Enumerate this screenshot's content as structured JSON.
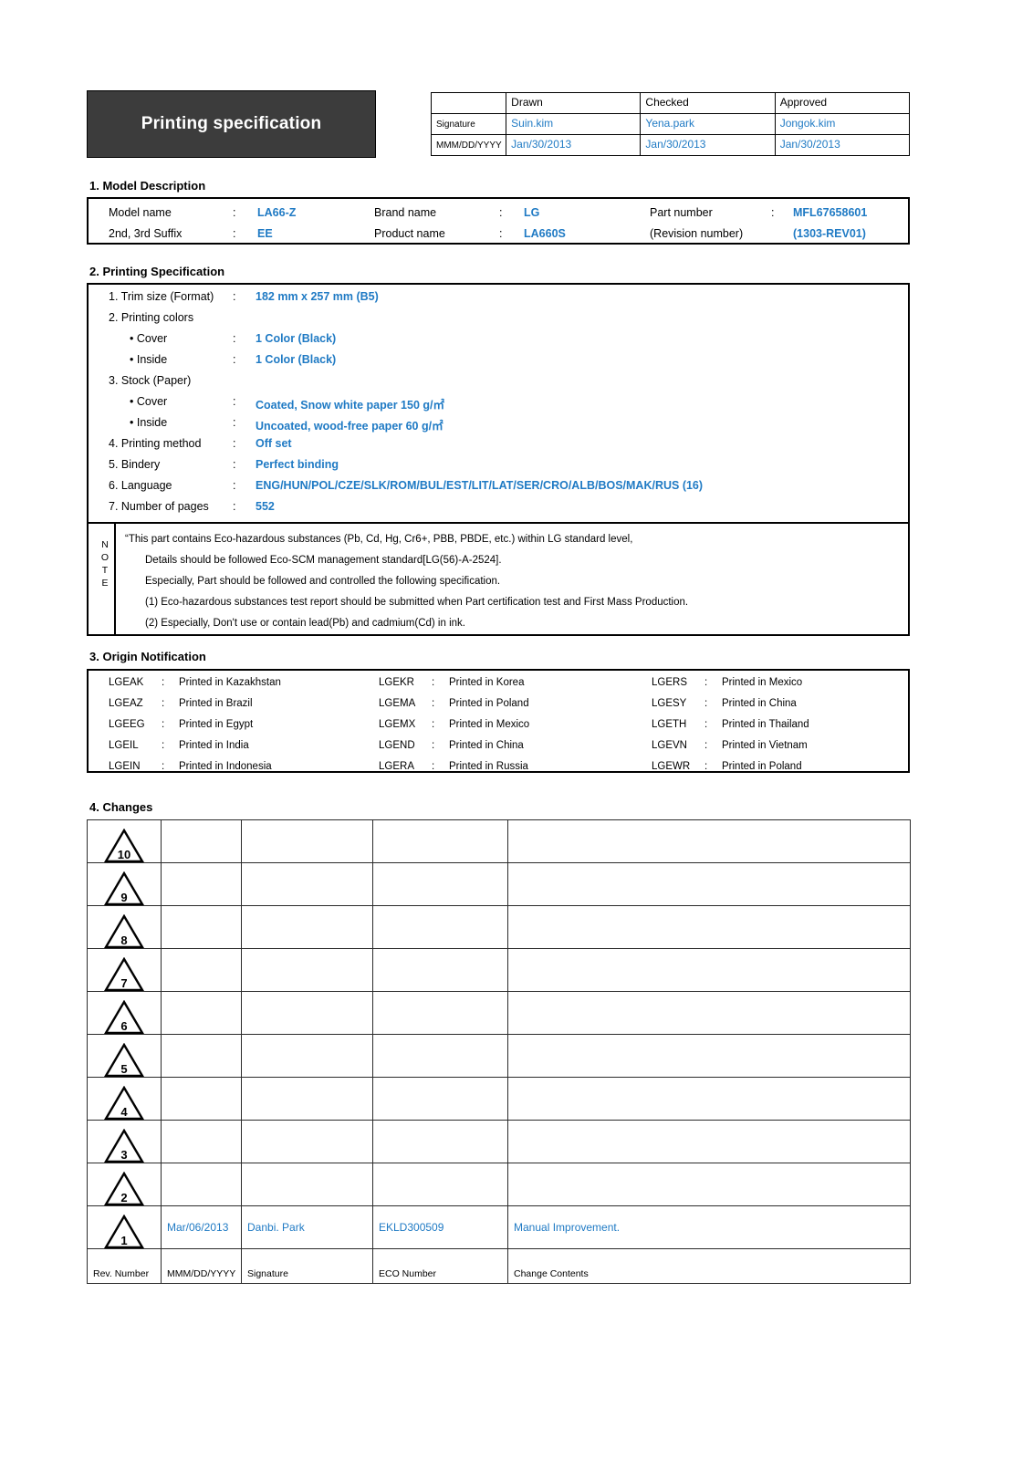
{
  "document": {
    "title": "Printing specification"
  },
  "approval_table": {
    "columns": [
      "Drawn",
      "Checked",
      "Approved"
    ],
    "rows": [
      {
        "label": "Signature",
        "values": [
          "Suin.kim",
          "Yena.park",
          "Jongok.kim"
        ]
      },
      {
        "label": "MMM/DD/YYYY",
        "values": [
          "Jan/30/2013",
          "Jan/30/2013",
          "Jan/30/2013"
        ]
      }
    ]
  },
  "sections": {
    "model_description": {
      "heading": "1. Model Description",
      "fields": [
        {
          "label": "Model name",
          "colon": ":",
          "value": "LA66-Z"
        },
        {
          "label": "2nd, 3rd Suffix",
          "colon": ":",
          "value": "EE"
        },
        {
          "label": "Brand name",
          "colon": ":",
          "value": "LG"
        },
        {
          "label": "Product name",
          "colon": ":",
          "value": "LA660S"
        },
        {
          "label": "Part number",
          "colon": ":",
          "value": "MFL67658601"
        },
        {
          "label": "(Revision number)",
          "colon": "",
          "value": "(1303-REV01)"
        }
      ]
    },
    "printing_specification": {
      "heading": "2. Printing Specification",
      "items": [
        {
          "label": "1. Trim size (Format)",
          "colon": ":",
          "value": "182 mm x 257 mm (B5)",
          "indent": false
        },
        {
          "label": "2. Printing colors",
          "colon": "",
          "value": "",
          "indent": false
        },
        {
          "label": "• Cover",
          "colon": ":",
          "value": "1 Color (Black)",
          "indent": true
        },
        {
          "label": "• Inside",
          "colon": ":",
          "value": "1 Color (Black)",
          "indent": true
        },
        {
          "label": "3. Stock (Paper)",
          "colon": "",
          "value": "",
          "indent": false
        },
        {
          "label": "• Cover",
          "colon": ":",
          "value": "Coated, Snow white paper 150 g/㎡",
          "indent": true
        },
        {
          "label": "• Inside",
          "colon": ":",
          "value": "Uncoated, wood-free paper 60 g/㎡",
          "indent": true
        },
        {
          "label": "4. Printing method",
          "colon": ":",
          "value": "Off set",
          "indent": false
        },
        {
          "label": "5. Bindery",
          "colon": ":",
          "value": "Perfect binding",
          "indent": false
        },
        {
          "label": "6. Language",
          "colon": ":",
          "value": "ENG/HUN/POL/CZE/SLK/ROM/BUL/EST/LIT/LAT/SER/CRO/ALB/BOS/MAK/RUS (16)",
          "indent": false
        },
        {
          "label": "7. Number of pages",
          "colon": ":",
          "value": "552",
          "indent": false
        }
      ],
      "note": {
        "label": "NOTE",
        "lines": [
          "“This part contains Eco-hazardous substances (Pb, Cd, Hg, Cr6+, PBB, PBDE, etc.) within LG standard level,",
          "Details should be followed Eco-SCM management standard[LG(56)-A-2524].",
          "Especially, Part should be followed and controlled the following specification.",
          "(1) Eco-hazardous substances test report should be submitted when Part certification test and First Mass Production.",
          "(2) Especially, Don't use or contain lead(Pb) and cadmium(Cd) in ink."
        ]
      }
    },
    "origin_notification": {
      "heading": "3. Origin Notification",
      "columns": [
        [
          {
            "code": "LGEAK",
            "colon": ":",
            "origin": "Printed in Kazakhstan"
          },
          {
            "code": "LGEAZ",
            "colon": ":",
            "origin": "Printed in Brazil"
          },
          {
            "code": "LGEEG",
            "colon": ":",
            "origin": "Printed in Egypt"
          },
          {
            "code": "LGEIL",
            "colon": ":",
            "origin": "Printed in India"
          },
          {
            "code": "LGEIN",
            "colon": ":",
            "origin": "Printed in Indonesia"
          }
        ],
        [
          {
            "code": "LGEKR",
            "colon": ":",
            "origin": "Printed in Korea"
          },
          {
            "code": "LGEMA",
            "colon": ":",
            "origin": "Printed in Poland"
          },
          {
            "code": "LGEMX",
            "colon": ":",
            "origin": "Printed in Mexico"
          },
          {
            "code": "LGEND",
            "colon": ":",
            "origin": "Printed in China"
          },
          {
            "code": "LGERA",
            "colon": ":",
            "origin": "Printed in Russia"
          }
        ],
        [
          {
            "code": "LGERS",
            "colon": ":",
            "origin": "Printed in Mexico"
          },
          {
            "code": "LGESY",
            "colon": ":",
            "origin": "Printed in China"
          },
          {
            "code": "LGETH",
            "colon": ":",
            "origin": "Printed in Thailand"
          },
          {
            "code": "LGEVN",
            "colon": ":",
            "origin": "Printed in Vietnam"
          },
          {
            "code": "LGEWR",
            "colon": ":",
            "origin": "Printed in Poland"
          }
        ]
      ]
    },
    "changes": {
      "heading": "4. Changes",
      "rows": [
        {
          "rev": "10",
          "date": "",
          "signature": "",
          "eco": "",
          "contents": ""
        },
        {
          "rev": "9",
          "date": "",
          "signature": "",
          "eco": "",
          "contents": ""
        },
        {
          "rev": "8",
          "date": "",
          "signature": "",
          "eco": "",
          "contents": ""
        },
        {
          "rev": "7",
          "date": "",
          "signature": "",
          "eco": "",
          "contents": ""
        },
        {
          "rev": "6",
          "date": "",
          "signature": "",
          "eco": "",
          "contents": ""
        },
        {
          "rev": "5",
          "date": "",
          "signature": "",
          "eco": "",
          "contents": ""
        },
        {
          "rev": "4",
          "date": "",
          "signature": "",
          "eco": "",
          "contents": ""
        },
        {
          "rev": "3",
          "date": "",
          "signature": "",
          "eco": "",
          "contents": ""
        },
        {
          "rev": "2",
          "date": "",
          "signature": "",
          "eco": "",
          "contents": ""
        },
        {
          "rev": "1",
          "date": "Mar/06/2013",
          "signature": "Danbi. Park",
          "eco": "EKLD300509",
          "contents": "Manual Improvement."
        }
      ],
      "footer": {
        "rev": "Rev. Number",
        "date": "MMM/DD/YYYY",
        "signature": "Signature",
        "eco": "ECO Number",
        "contents": "Change Contents"
      }
    }
  },
  "colors": {
    "accent_blue": "#1f7ac4",
    "title_block_bg": "#3c3c3c",
    "border": "#000000"
  }
}
